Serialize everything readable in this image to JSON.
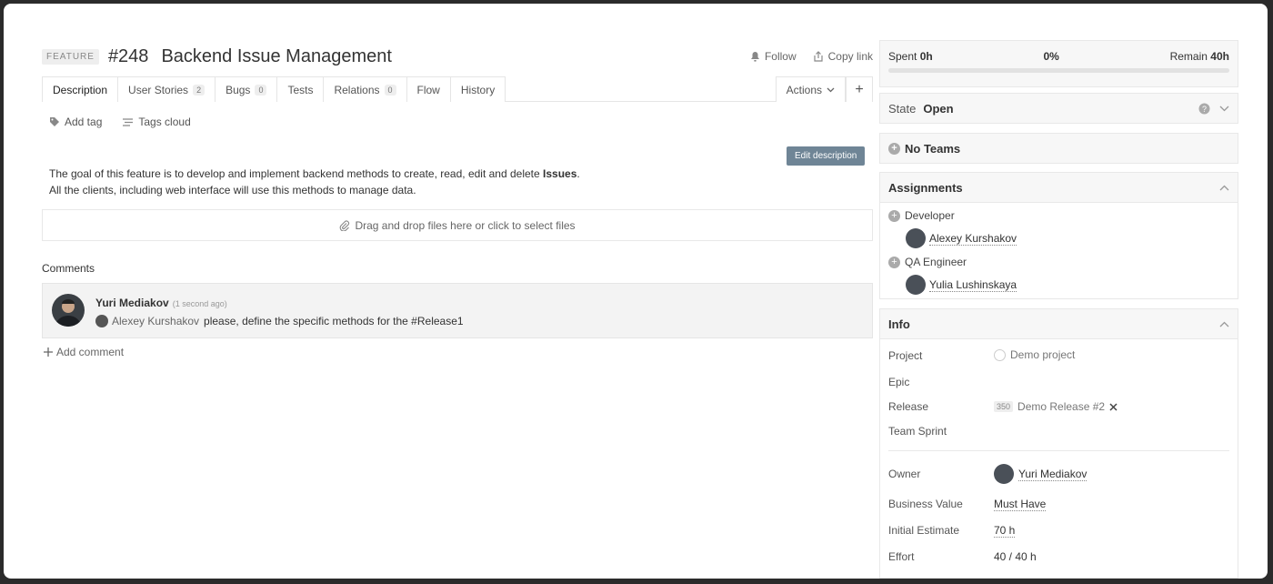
{
  "header": {
    "type_badge": "FEATURE",
    "number": "#248",
    "title": "Backend Issue Management",
    "follow_label": "Follow",
    "copy_link_label": "Copy link"
  },
  "tabs": [
    {
      "label": "Description",
      "count": null
    },
    {
      "label": "User Stories",
      "count": "2"
    },
    {
      "label": "Bugs",
      "count": "0"
    },
    {
      "label": "Tests",
      "count": null
    },
    {
      "label": "Relations",
      "count": "0"
    },
    {
      "label": "Flow",
      "count": null
    },
    {
      "label": "History",
      "count": null
    }
  ],
  "tabs_right": {
    "actions_label": "Actions",
    "add_label": "+"
  },
  "tags": {
    "add_tag": "Add tag",
    "tags_cloud": "Tags cloud"
  },
  "description": {
    "edit_label": "Edit description",
    "line1_prefix": "The goal of this feature is to develop and implement backend methods to create, read, edit and delete ",
    "line1_bold": "Issues",
    "line1_suffix": ".",
    "line2": "All the clients, including web interface will use this methods to manage data."
  },
  "dropzone": {
    "label": "Drag and drop files here or click to select files"
  },
  "comments": {
    "heading": "Comments",
    "items": [
      {
        "author": "Yuri Mediakov",
        "time": "(1 second ago)",
        "mention": "Alexey Kurshakov",
        "text": "please, define the specific methods for the #Release1"
      }
    ],
    "add_label": "Add comment"
  },
  "progress": {
    "spent_label": "Spent",
    "spent_value": "0h",
    "percent": "0%",
    "percent_value": 0,
    "remain_label": "Remain",
    "remain_value": "40h"
  },
  "state": {
    "label": "State",
    "value": "Open"
  },
  "teams": {
    "label": "No Teams"
  },
  "assignments": {
    "heading": "Assignments",
    "roles": [
      {
        "role": "Developer",
        "person": "Alexey Kurshakov"
      },
      {
        "role": "QA Engineer",
        "person": "Yulia Lushinskaya"
      }
    ]
  },
  "info": {
    "heading": "Info",
    "project_label": "Project",
    "project_value": "Demo project",
    "epic_label": "Epic",
    "release_label": "Release",
    "release_badge": "350",
    "release_value": "Demo Release #2",
    "team_sprint_label": "Team Sprint",
    "owner_label": "Owner",
    "owner_value": "Yuri Mediakov",
    "business_value_label": "Business Value",
    "business_value_value": "Must Have",
    "initial_estimate_label": "Initial Estimate",
    "initial_estimate_value": "70 h",
    "effort_label": "Effort",
    "effort_value": "40 / 40 h"
  },
  "colors": {
    "accent": "#6f8596",
    "progress": "#8ab0d0"
  }
}
